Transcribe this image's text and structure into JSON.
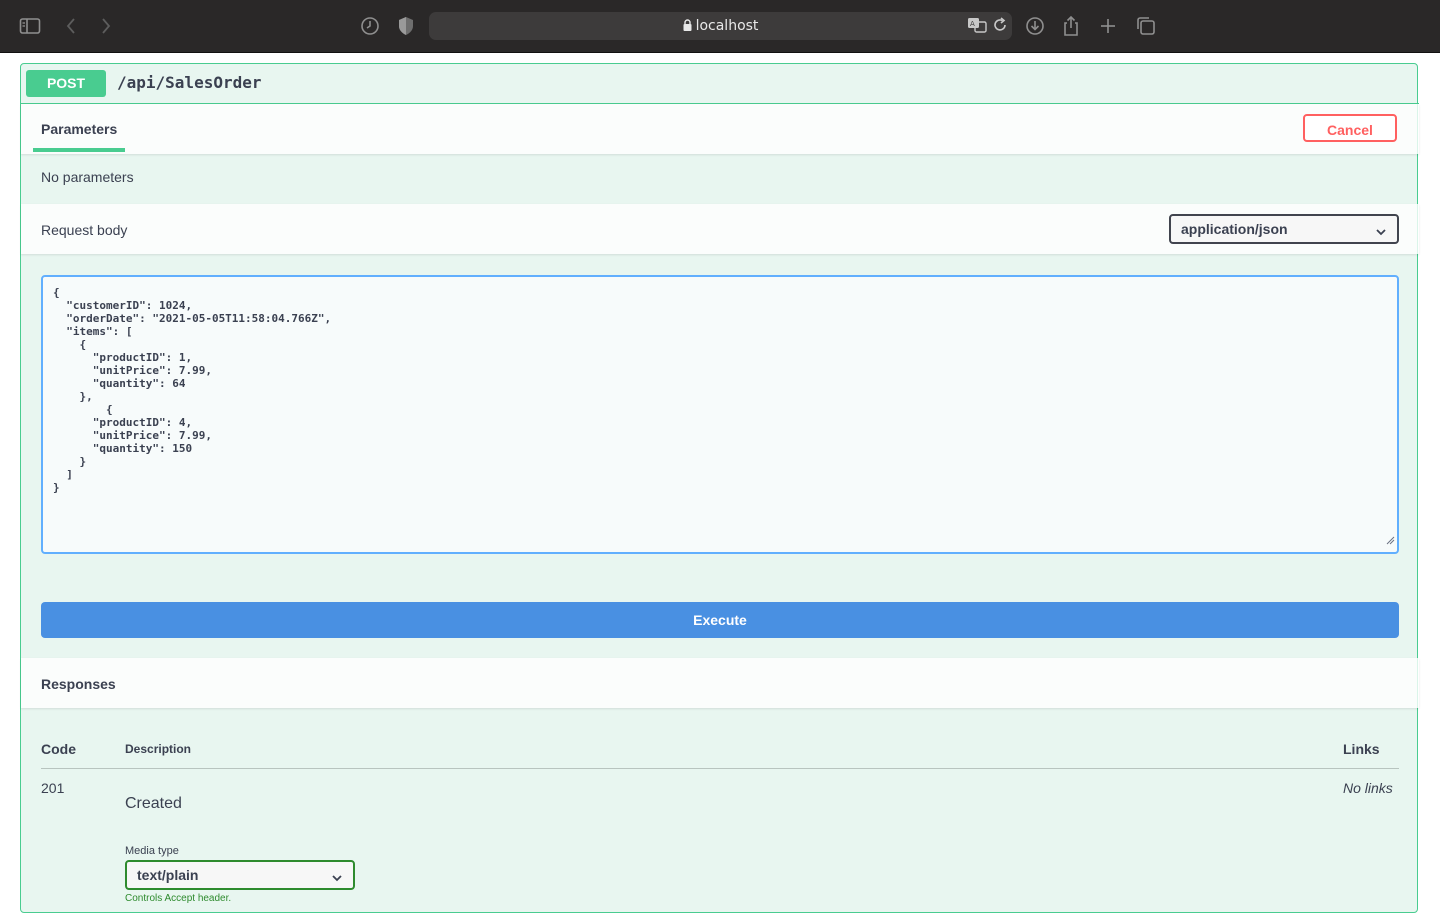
{
  "browser": {
    "url": "localhost",
    "icons": [
      "sidebar-icon",
      "back-icon",
      "forward-icon",
      "history-icon",
      "privacy-shield-icon",
      "lock-icon",
      "translate-icon",
      "reload-icon",
      "download-icon",
      "share-icon",
      "new-tab-icon",
      "tab-overview-icon"
    ]
  },
  "operation": {
    "method": "POST",
    "path": "/api/SalesOrder",
    "accent_color": "#49cc90"
  },
  "parameters": {
    "tab_label": "Parameters",
    "cancel_label": "Cancel",
    "empty_text": "No parameters"
  },
  "request_body": {
    "label": "Request body",
    "content_type": "application/json",
    "body": "{\n  \"customerID\": 1024,\n  \"orderDate\": \"2021-05-05T11:58:04.766Z\",\n  \"items\": [\n    {\n      \"productID\": 1,\n      \"unitPrice\": 7.99,\n      \"quantity\": 64\n    },\n        {\n      \"productID\": 4,\n      \"unitPrice\": 7.99,\n      \"quantity\": 150\n    }\n  ]\n}"
  },
  "execute_label": "Execute",
  "responses": {
    "title": "Responses",
    "headers": {
      "code": "Code",
      "description": "Description",
      "links": "Links"
    },
    "rows": [
      {
        "code": "201",
        "description": "Created",
        "links": "No links",
        "media_type_label": "Media type",
        "media_type": "text/plain",
        "controls_note": "Controls Accept header."
      }
    ]
  }
}
